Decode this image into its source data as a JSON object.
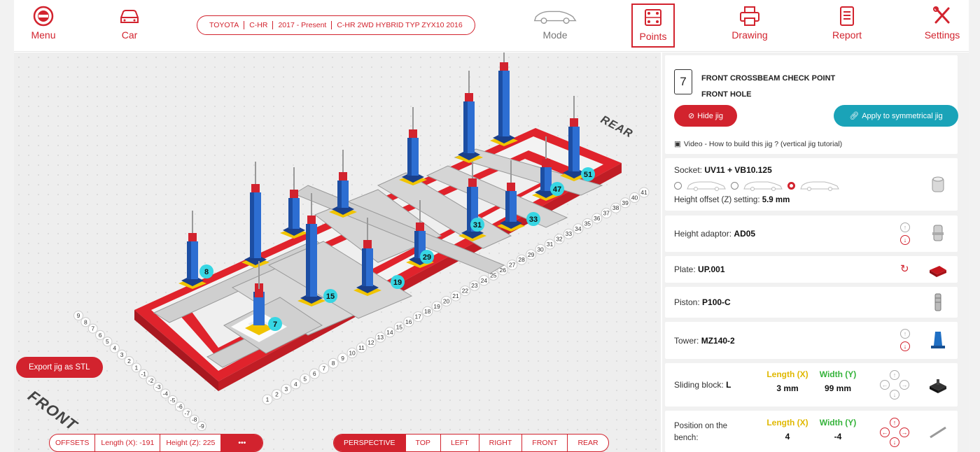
{
  "nav": {
    "menu": "Menu",
    "car": "Car",
    "mode": "Mode",
    "points": "Points",
    "drawing": "Drawing",
    "report": "Report",
    "settings": "Settings"
  },
  "car_info": [
    "TOYOTA",
    "C-HR",
    "2017 - Present",
    "C-HR 2WD HYBRID TYP ZYX10 2016"
  ],
  "view": {
    "front_label": "FRONT",
    "rear_label": "REAR",
    "export_btn": "Export jig as STL",
    "offsets": {
      "label": "OFFSETS",
      "length": "Length (X): -191",
      "height": "Height (Z): 225",
      "more": "•••"
    },
    "tabs": [
      "PERSPECTIVE",
      "TOP",
      "LEFT",
      "RIGHT",
      "FRONT",
      "REAR"
    ],
    "active_tab": "PERSPECTIVE",
    "point_labels": [
      "8",
      "15",
      "7",
      "19",
      "29",
      "31",
      "33",
      "47",
      "51"
    ],
    "ruler_front_numbers": [
      "1",
      "2",
      "3",
      "4",
      "5",
      "6",
      "7",
      "8",
      "9",
      "10",
      "11",
      "12",
      "13",
      "14",
      "15",
      "16",
      "17",
      "18",
      "19",
      "20",
      "21",
      "22",
      "23",
      "24",
      "25",
      "26",
      "27",
      "28",
      "29",
      "30",
      "31",
      "32",
      "33",
      "34",
      "35",
      "36",
      "37",
      "38",
      "39",
      "40",
      "41"
    ],
    "ruler_side_numbers": [
      "9",
      "8",
      "7",
      "6",
      "5",
      "4",
      "3",
      "2",
      "1",
      "-1",
      "-2",
      "-3",
      "-4",
      "-5",
      "-6",
      "-7",
      "-8",
      "-9"
    ]
  },
  "panel": {
    "point_number": "7",
    "title_line1": "FRONT CROSSBEAM CHECK POINT",
    "title_line2": "FRONT HOLE",
    "hide_jig": "Hide jig",
    "apply_sym": "Apply to symmetrical jig",
    "video_link": "Video - How to build this jig ? (vertical jig tutorial)",
    "socket": {
      "label": "Socket:",
      "value": "UV11 + VB10.125",
      "height_label": "Height offset (Z) setting:",
      "height_value": "5.9 mm"
    },
    "height_adaptor": {
      "label": "Height adaptor:",
      "value": "AD05"
    },
    "plate": {
      "label": "Plate:",
      "value": "UP.001"
    },
    "piston": {
      "label": "Piston:",
      "value": "P100-C"
    },
    "tower": {
      "label": "Tower:",
      "value": "MZ140-2"
    },
    "sliding_block": {
      "label": "Sliding block:",
      "value": "L",
      "length_head": "Length (X)",
      "width_head": "Width (Y)",
      "length_val": "3 mm",
      "width_val": "99 mm"
    },
    "position": {
      "label_line1": "Position on the",
      "label_line2": "bench:",
      "length_head": "Length (X)",
      "width_head": "Width (Y)",
      "length_val": "4",
      "width_val": "-4"
    }
  },
  "colors": {
    "accent": "#d2232e",
    "teal": "#1aa3b8",
    "length": "#e0b800",
    "width": "#35b33b"
  }
}
